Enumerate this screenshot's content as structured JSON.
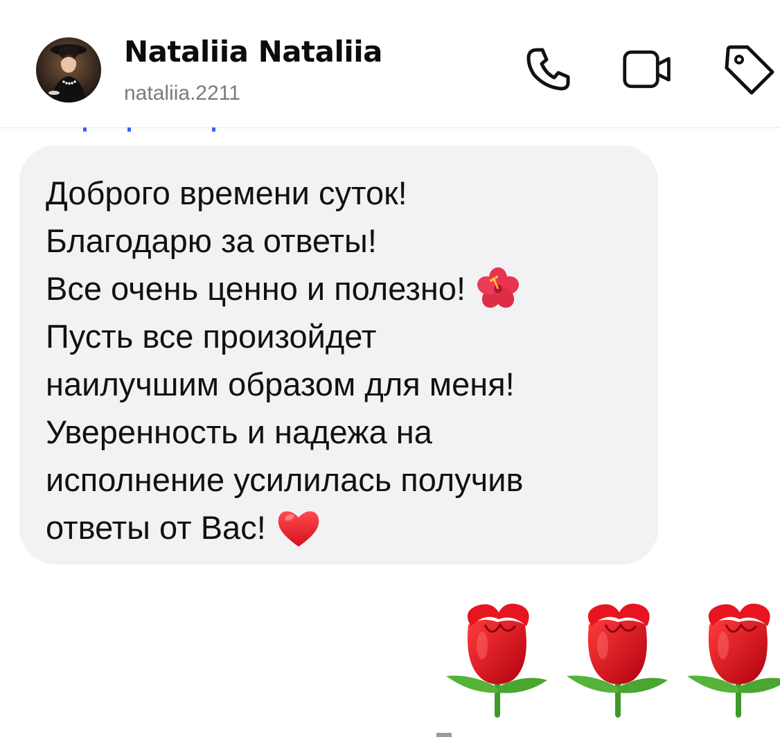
{
  "header": {
    "name": "Nataliia Nataliia",
    "username": "nataliia.2211",
    "actions": [
      {
        "icon": "phone-icon",
        "label": "call"
      },
      {
        "icon": "video-camera-icon",
        "label": "video call"
      },
      {
        "icon": "tag-icon",
        "label": "tag"
      }
    ]
  },
  "message": {
    "lines": [
      "Доброго времени суток!",
      "Благодарю за ответы!",
      "Все очень ценно и полезно!",
      "Пусть все произойдет",
      "наилучшим образом для меня!",
      "Уверенность и надежа на",
      "исполнение усилилась получив",
      "ответы от Вас!"
    ],
    "emojis": {
      "line3": "hibiscus-emoji",
      "line8": "red-heart-emoji"
    }
  },
  "reply": {
    "emojis": [
      "rose-emoji",
      "rose-emoji",
      "rose-emoji"
    ]
  },
  "colors": {
    "bubble_bg": "#f2f2f5",
    "text": "#111111",
    "muted": "#7a7a80",
    "accent_link": "#3c63e6"
  }
}
